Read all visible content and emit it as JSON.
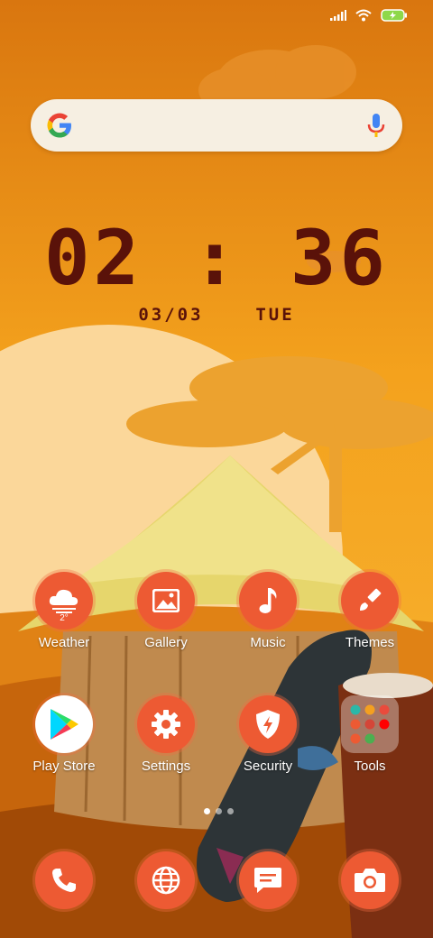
{
  "status_bar": {
    "icons": [
      "signal-icon",
      "wifi-icon",
      "battery-charging-icon"
    ]
  },
  "search": {
    "logo": "google-g-icon",
    "mic": "microphone-icon"
  },
  "clock": {
    "time": "02 : 36",
    "date": "03/03",
    "day": "TUE"
  },
  "apps": {
    "weather": {
      "label": "Weather",
      "temp": "2°"
    },
    "gallery": {
      "label": "Gallery"
    },
    "music": {
      "label": "Music"
    },
    "themes": {
      "label": "Themes"
    },
    "play_store": {
      "label": "Play Store"
    },
    "settings": {
      "label": "Settings"
    },
    "security": {
      "label": "Security"
    },
    "tools": {
      "label": "Tools"
    }
  },
  "dock": [
    "phone-icon",
    "browser-icon",
    "messages-icon",
    "camera-icon"
  ],
  "page_indicator": {
    "pages": 3,
    "active": 1
  },
  "colors": {
    "accent": "#ed5a33",
    "clock": "#5a1209",
    "sky": "#f2a11e"
  }
}
